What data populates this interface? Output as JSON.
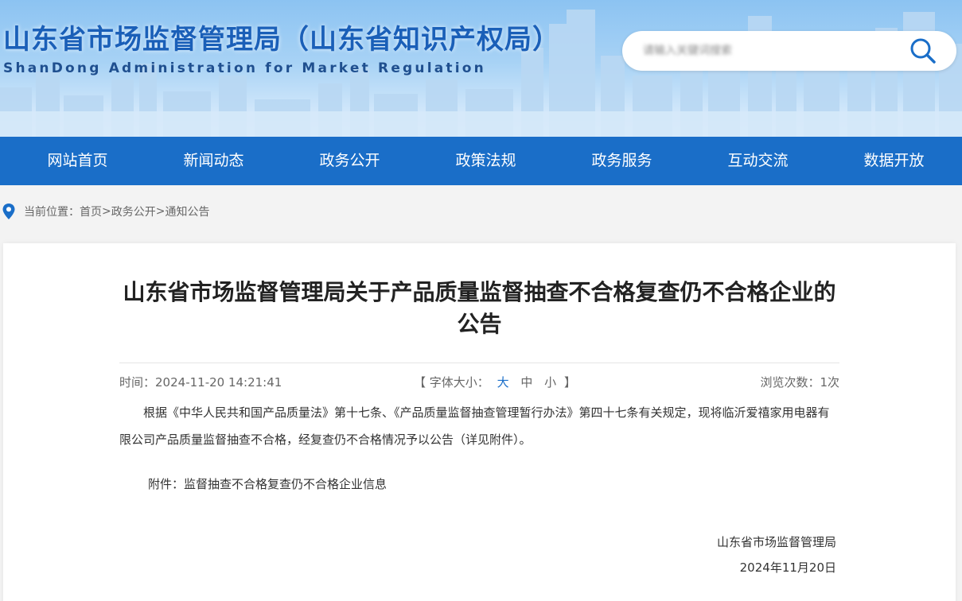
{
  "header": {
    "title": "山东省市场监督管理局（山东省知识产权局）",
    "subtitle": "ShanDong Administration for Market Regulation",
    "search_placeholder": "请输入关键词搜索"
  },
  "nav": {
    "items": [
      "网站首页",
      "新闻动态",
      "政务公开",
      "政策法规",
      "政务服务",
      "互动交流",
      "数据开放"
    ]
  },
  "breadcrumb": {
    "prefix": "当前位置：",
    "items": [
      "首页",
      "政务公开",
      "通知公告"
    ],
    "separator": ">"
  },
  "article": {
    "title": "山东省市场监督管理局关于产品质量监督抽查不合格复查仍不合格企业的公告",
    "time_label": "时间：",
    "time": "2024-11-20 14:21:41",
    "font_size_label": "【 字体大小：",
    "font_size_options": [
      "大",
      "中",
      "小"
    ],
    "font_size_close": "】",
    "views_label": "浏览次数：",
    "views": "1次",
    "body": "根据《中华人民共和国产品质量法》第十七条、《产品质量监督抽查管理暂行办法》第四十七条有关规定，现将临沂爱禧家用电器有限公司产品质量监督抽查不合格，经复查仍不合格情况予以公告（详见附件）。",
    "attachment_label": "附件：",
    "attachment_name": "监督抽查不合格复查仍不合格企业信息",
    "signature_org": "山东省市场监督管理局",
    "signature_date": "2024年11月20日"
  },
  "colors": {
    "nav_bg": "#1a6ec8",
    "title_blue": "#1a5fb8",
    "active_font_size": "#1a6ec8"
  }
}
